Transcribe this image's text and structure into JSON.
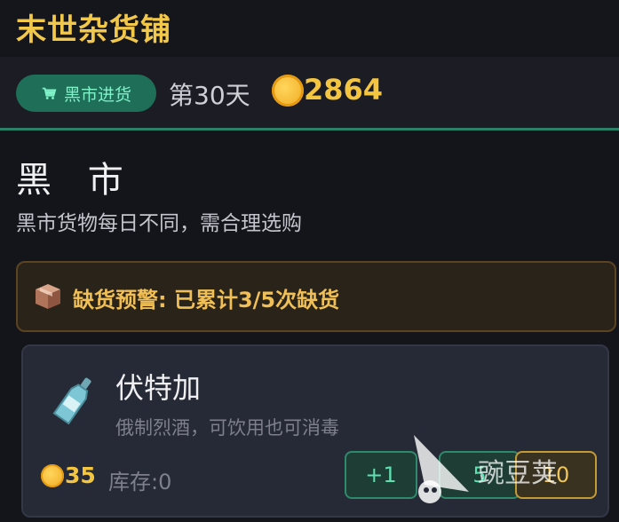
{
  "app": {
    "title": "末世杂货铺"
  },
  "status": {
    "market_button_label": "黑市进货",
    "day_label": "第30天",
    "coins": "2864"
  },
  "section": {
    "title": "黑 市",
    "subtitle": "黑市货物每日不同，需合理选购"
  },
  "warning": {
    "text": "缺货预警: 已累计3/5次缺货"
  },
  "item": {
    "name": "伏特加",
    "description": "俄制烈酒，可饮用也可消毒",
    "price": "35",
    "stock": "库存:0",
    "buttons": {
      "plus1": "+1",
      "plus5": "5",
      "plus10": "10"
    }
  },
  "watermark": {
    "text": "豌豆荚"
  },
  "colors": {
    "accent": "#f2c84b",
    "green": "#1f6e58",
    "coin": "#f4c53e"
  }
}
